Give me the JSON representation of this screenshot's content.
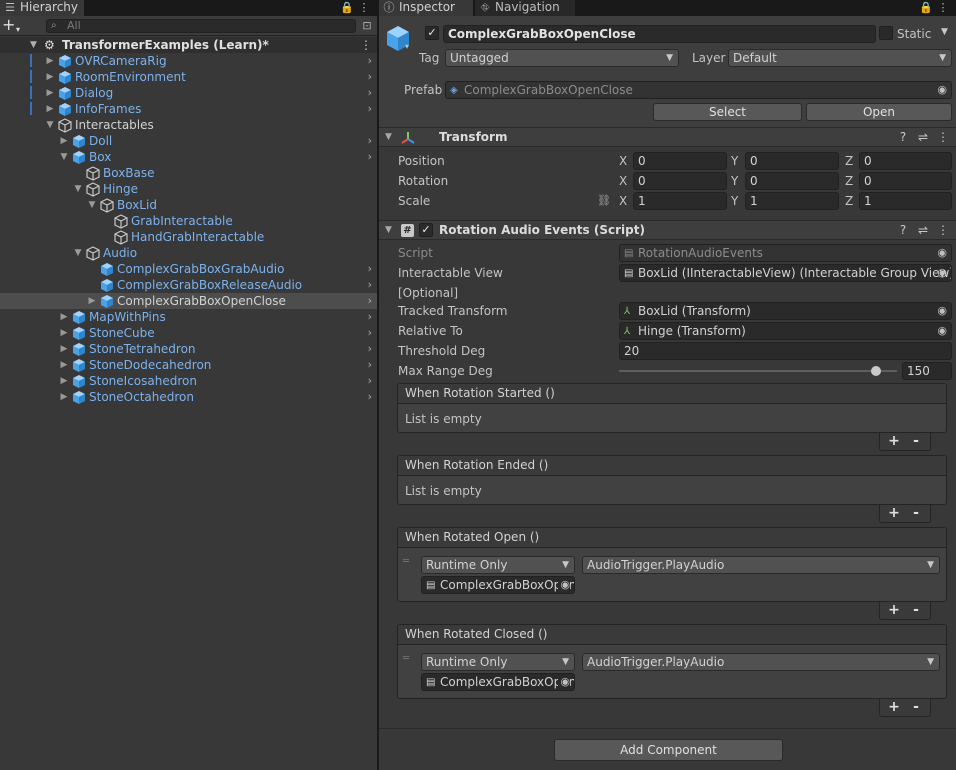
{
  "colors": {
    "accent_blue": "#7cb2ed",
    "selection": "#4d4d4d",
    "background": "#383838"
  },
  "hierarchy": {
    "tab_label": "Hierarchy",
    "search_placeholder": "All",
    "scene_name": "TransformerExamples (Learn)*",
    "items": [
      {
        "label": "OVRCameraRig",
        "color": "blue",
        "expandable": true,
        "expanded": false,
        "prefab": true
      },
      {
        "label": "RoomEnvironment",
        "color": "blue",
        "expandable": true,
        "expanded": false,
        "prefab": true
      },
      {
        "label": "Dialog",
        "color": "blue",
        "expandable": true,
        "expanded": false,
        "prefab": true
      },
      {
        "label": "InfoFrames",
        "color": "blue",
        "expandable": true,
        "expanded": false,
        "prefab": true
      },
      {
        "label": "Interactables",
        "color": "white",
        "expandable": true,
        "expanded": true,
        "prefab": false
      },
      {
        "label": "Doll",
        "color": "blue",
        "expandable": true,
        "expanded": false,
        "prefab": true
      },
      {
        "label": "Box",
        "color": "blue",
        "expandable": true,
        "expanded": true,
        "prefab": true
      },
      {
        "label": "BoxBase",
        "color": "blue",
        "expandable": false,
        "expanded": false,
        "prefab": false
      },
      {
        "label": "Hinge",
        "color": "blue",
        "expandable": true,
        "expanded": true,
        "prefab": false
      },
      {
        "label": "BoxLid",
        "color": "blue",
        "expandable": true,
        "expanded": true,
        "prefab": false
      },
      {
        "label": "GrabInteractable",
        "color": "blue",
        "expandable": false,
        "expanded": false,
        "prefab": false
      },
      {
        "label": "HandGrabInteractable",
        "color": "blue",
        "expandable": false,
        "expanded": false,
        "prefab": false
      },
      {
        "label": "Audio",
        "color": "blue",
        "expandable": true,
        "expanded": true,
        "prefab": false
      },
      {
        "label": "ComplexGrabBoxGrabAudio",
        "color": "blue",
        "expandable": false,
        "expanded": false,
        "prefab": true
      },
      {
        "label": "ComplexGrabBoxReleaseAudio",
        "color": "blue",
        "expandable": false,
        "expanded": false,
        "prefab": true
      },
      {
        "label": "ComplexGrabBoxOpenClose",
        "color": "white",
        "expandable": true,
        "expanded": false,
        "prefab": true,
        "selected": true
      },
      {
        "label": "MapWithPins",
        "color": "blue",
        "expandable": true,
        "expanded": false,
        "prefab": true
      },
      {
        "label": "StoneCube",
        "color": "blue",
        "expandable": true,
        "expanded": false,
        "prefab": true
      },
      {
        "label": "StoneTetrahedron",
        "color": "blue",
        "expandable": true,
        "expanded": false,
        "prefab": true
      },
      {
        "label": "StoneDodecahedron",
        "color": "blue",
        "expandable": true,
        "expanded": false,
        "prefab": true
      },
      {
        "label": "StoneIcosahedron",
        "color": "blue",
        "expandable": true,
        "expanded": false,
        "prefab": true
      },
      {
        "label": "StoneOctahedron",
        "color": "blue",
        "expandable": true,
        "expanded": false,
        "prefab": true
      }
    ]
  },
  "inspector": {
    "tab_label": "Inspector",
    "nav_tab_label": "Navigation",
    "object_name": "ComplexGrabBoxOpenClose",
    "static_label": "Static",
    "tag_label": "Tag",
    "tag_value": "Untagged",
    "layer_label": "Layer",
    "layer_value": "Default",
    "prefab_label": "Prefab",
    "prefab_value": "ComplexGrabBoxOpenClose",
    "select_label": "Select",
    "open_label": "Open",
    "transform": {
      "title": "Transform",
      "position_label": "Position",
      "rotation_label": "Rotation",
      "scale_label": "Scale",
      "axis_x": "X",
      "axis_y": "Y",
      "axis_z": "Z",
      "position": [
        "0",
        "0",
        "0"
      ],
      "rotation": [
        "0",
        "0",
        "0"
      ],
      "scale": [
        "1",
        "1",
        "1"
      ]
    },
    "script_component": {
      "title": "Rotation Audio Events (Script)",
      "script_label": "Script",
      "script_value": "RotationAudioEvents",
      "interactable_view_label": "Interactable View",
      "interactable_view_value": "BoxLid (IInteractableView) (Interactable Group View)",
      "optional_label": "[Optional]",
      "tracked_transform_label": "Tracked Transform",
      "tracked_transform_value": "BoxLid (Transform)",
      "relative_to_label": "Relative To",
      "relative_to_value": "Hinge (Transform)",
      "threshold_label": "Threshold Deg",
      "threshold_value": "20",
      "max_range_label": "Max Range Deg",
      "max_range_value": "150",
      "max_range_fraction": 0.9
    },
    "events": [
      {
        "title": "When Rotation Started ()",
        "empty_text": "List is empty"
      },
      {
        "title": "When Rotation Ended ()",
        "empty_text": "List is empty"
      },
      {
        "title": "When Rotated Open ()",
        "runtime": "Runtime Only",
        "function": "AudioTrigger.PlayAudio",
        "object": "ComplexGrabBoxOpenClose"
      },
      {
        "title": "When Rotated Closed ()",
        "runtime": "Runtime Only",
        "function": "AudioTrigger.PlayAudio",
        "object": "ComplexGrabBoxOpenClose"
      }
    ],
    "plus_label": "+",
    "minus_label": "-",
    "add_component_label": "Add Component"
  }
}
